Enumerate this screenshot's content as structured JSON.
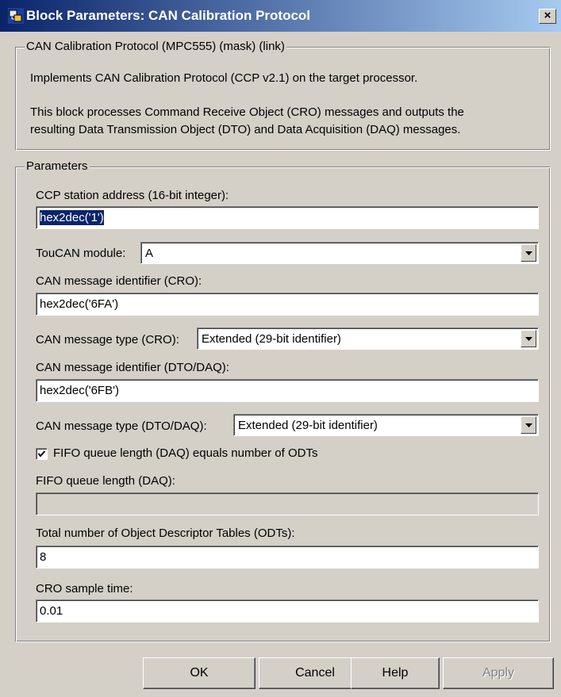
{
  "window": {
    "title": "Block Parameters: CAN Calibration Protocol",
    "close_label": "×"
  },
  "description_group": {
    "legend": "CAN Calibration Protocol (MPC555) (mask) (link)",
    "line1": "Implements CAN Calibration Protocol (CCP v2.1) on the target processor.",
    "line2": "This block processes Command Receive Object (CRO) messages and outputs the",
    "line3": "resulting Data Transmission Object (DTO) and Data Acquisition (DAQ) messages."
  },
  "parameters_group": {
    "legend": "Parameters",
    "station_address": {
      "label": "CCP station address (16-bit integer):",
      "value": "hex2dec('1')"
    },
    "toucan_module": {
      "label": "TouCAN module:",
      "value": "A"
    },
    "cro_identifier": {
      "label": "CAN message identifier (CRO):",
      "value": "hex2dec('6FA')"
    },
    "cro_type": {
      "label": "CAN message type (CRO):",
      "value": "Extended (29-bit identifier)"
    },
    "dto_identifier": {
      "label": "CAN message identifier (DTO/DAQ):",
      "value": "hex2dec('6FB')"
    },
    "dto_type": {
      "label": "CAN message type (DTO/DAQ):",
      "value": "Extended (29-bit identifier)"
    },
    "fifo_checkbox": {
      "label": "FIFO queue length (DAQ) equals number of ODTs",
      "checked": true
    },
    "fifo_length": {
      "label": "FIFO queue length (DAQ):",
      "value": ""
    },
    "odt_count": {
      "label": "Total number of Object Descriptor Tables (ODTs):",
      "value": "8"
    },
    "cro_sample_time": {
      "label": "CRO sample time:",
      "value": "0.01"
    }
  },
  "buttons": {
    "ok": "OK",
    "cancel": "Cancel",
    "help": "Help",
    "apply": "Apply"
  },
  "colors": {
    "title_gradient_start": "#0a246a",
    "title_gradient_end": "#a6caf0",
    "dialog_face": "#d4d0c8",
    "selection": "#0a246a"
  },
  "icons": {
    "app": "simulink-block-icon",
    "close": "close-icon",
    "dropdown": "chevron-down-icon",
    "check": "check-icon"
  }
}
